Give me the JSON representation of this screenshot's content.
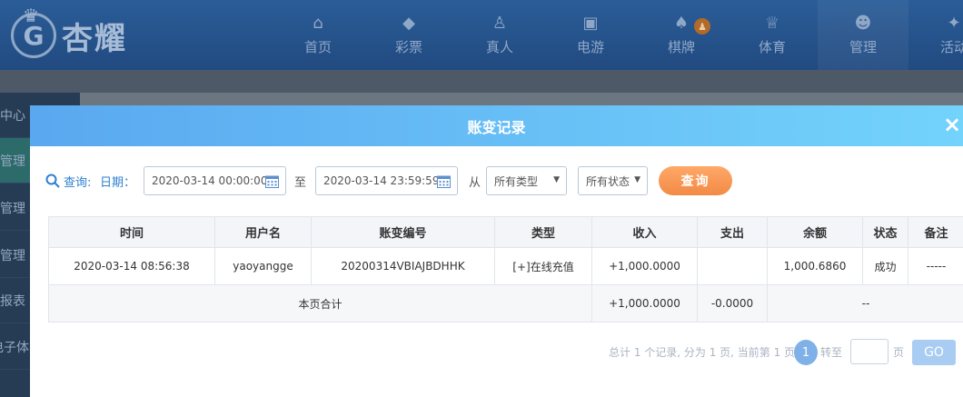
{
  "brand": {
    "name": "杏耀"
  },
  "nav": [
    {
      "label": "首页",
      "icon": "home-icon"
    },
    {
      "label": "彩票",
      "icon": "lottery-icon"
    },
    {
      "label": "真人",
      "icon": "live-dealer-icon"
    },
    {
      "label": "电游",
      "icon": "slot-game-icon"
    },
    {
      "label": "棋牌",
      "icon": "card-game-icon"
    },
    {
      "label": "体育",
      "icon": "trophy-icon"
    },
    {
      "label": "管理",
      "icon": "users-icon"
    },
    {
      "label": "活动",
      "icon": "promo-icon"
    }
  ],
  "sidebar": {
    "items": [
      {
        "label": "中心"
      },
      {
        "label": "管理"
      },
      {
        "label": "管理"
      },
      {
        "label": "管理"
      },
      {
        "label": "报表"
      },
      {
        "label": "电子体"
      }
    ]
  },
  "modal": {
    "title": "账变记录",
    "close": "×"
  },
  "filter": {
    "search_label": "查询:",
    "date_label": "日期：",
    "start_date": "2020-03-14 00:00:00",
    "to_label": "至",
    "end_date": "2020-03-14 23:59:59",
    "from_label": "从",
    "type_select": "所有类型",
    "status_select": "所有状态",
    "query_button": "查询"
  },
  "table": {
    "headers": [
      "时间",
      "用户名",
      "账变编号",
      "类型",
      "收入",
      "支出",
      "余额",
      "状态",
      "备注"
    ],
    "rows": [
      {
        "time": "2020-03-14 08:56:38",
        "username": "yaoyangge",
        "record_id": "20200314VBIAJBDHHK",
        "type": "[+]在线充值",
        "income": "+1,000.0000",
        "expense": "",
        "balance": "1,000.6860",
        "status": "成功",
        "note": "-----"
      }
    ],
    "summary": {
      "label": "本页合计",
      "income": "+1,000.0000",
      "expense": "-0.0000",
      "rest": "--"
    }
  },
  "pager": {
    "summary": "总计 1 个记录, 分为 1 页, 当前第 1 页",
    "current_page": "1",
    "goto_label": "转至",
    "page_unit": "页",
    "go_button": "GO"
  },
  "colors": {
    "header_gradient_start": "#5aa8f0",
    "header_gradient_end": "#73d3fb",
    "query_button": "#f28a45",
    "income": "#4d8f2b",
    "link_blue": "#2d7fd0"
  }
}
